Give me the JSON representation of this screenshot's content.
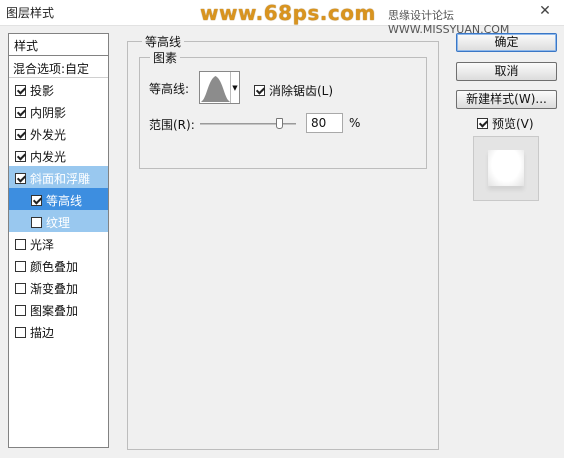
{
  "window": {
    "title": "图层样式",
    "close_glyph": "✕"
  },
  "watermark": {
    "text": "www.68ps.com",
    "site": "思缘设计论坛 WWW.MISSYUAN.COM"
  },
  "sidebar": {
    "header": "样式",
    "blend_options": "混合选项:自定",
    "items": [
      {
        "label": "投影",
        "checked": true
      },
      {
        "label": "内阴影",
        "checked": true
      },
      {
        "label": "外发光",
        "checked": true
      },
      {
        "label": "内发光",
        "checked": true
      },
      {
        "label": "斜面和浮雕",
        "checked": true
      },
      {
        "label": "等高线",
        "checked": true
      },
      {
        "label": "纹理",
        "checked": false
      },
      {
        "label": "光泽",
        "checked": false
      },
      {
        "label": "颜色叠加",
        "checked": false
      },
      {
        "label": "渐变叠加",
        "checked": false
      },
      {
        "label": "图案叠加",
        "checked": false
      },
      {
        "label": "描边",
        "checked": false
      }
    ]
  },
  "panel": {
    "title": "等高线",
    "group_title": "图素",
    "contour_label": "等高线:",
    "antialias_label": "消除锯齿(L)",
    "antialias_checked": true,
    "range_label": "范围(R):",
    "range_value": "80",
    "range_unit": "%",
    "range_fraction": 0.8
  },
  "buttons": {
    "ok": "确定",
    "cancel": "取消",
    "new_style": "新建样式(W)...",
    "preview_label": "预览(V)",
    "preview_checked": true
  },
  "colors": {
    "selected_light": "#99c8ef",
    "selected_dark": "#3d8ee0",
    "watermark": "#d9941f"
  }
}
